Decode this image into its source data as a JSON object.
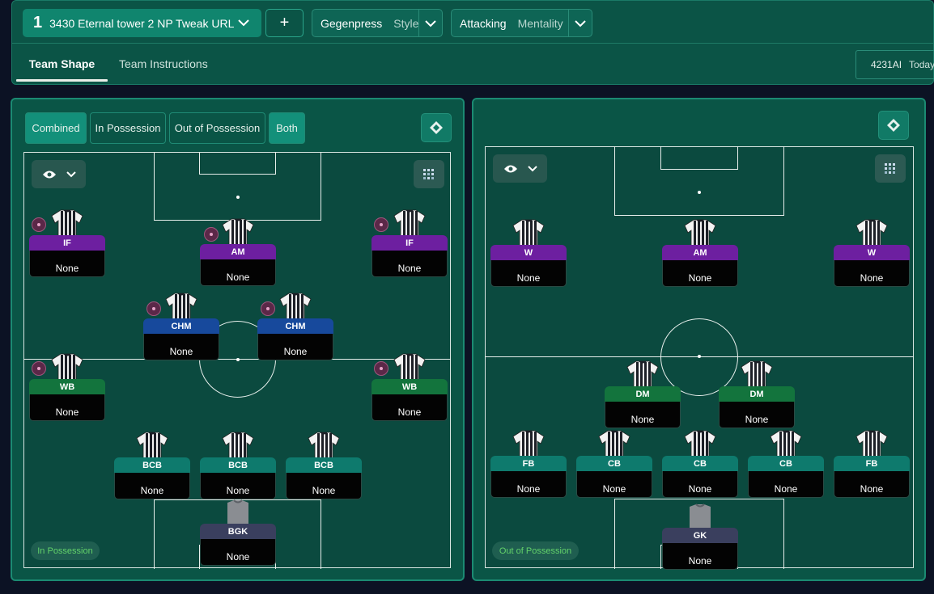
{
  "topbar": {
    "tactic_number": "1",
    "tactic_name": "3430 Eternal tower 2 NP Tweak URL",
    "add_label": "+",
    "style_value": "Gegenpress",
    "style_label": "Style",
    "mentality_value": "Attacking",
    "mentality_label": "Mentality",
    "tabs": [
      "Team Shape",
      "Team Instructions"
    ],
    "formation_code": "4231AI",
    "date_label": "Today"
  },
  "left_panel": {
    "segments": [
      "Combined",
      "In Possession",
      "Out of Possession",
      "Both"
    ],
    "badge": "In Possession",
    "players": [
      {
        "role": "IF",
        "duty": "None",
        "color": "#6d1fa0"
      },
      {
        "role": "AM",
        "duty": "None",
        "color": "#6d1fa0"
      },
      {
        "role": "IF",
        "duty": "None",
        "color": "#6d1fa0"
      },
      {
        "role": "CHM",
        "duty": "None",
        "color": "#17499c"
      },
      {
        "role": "CHM",
        "duty": "None",
        "color": "#17499c"
      },
      {
        "role": "WB",
        "duty": "None",
        "color": "#13743d"
      },
      {
        "role": "WB",
        "duty": "None",
        "color": "#13743d"
      },
      {
        "role": "BCB",
        "duty": "None",
        "color": "#0e7a6d"
      },
      {
        "role": "BCB",
        "duty": "None",
        "color": "#0e7a6d"
      },
      {
        "role": "BCB",
        "duty": "None",
        "color": "#0e7a6d"
      },
      {
        "role": "BGK",
        "duty": "None",
        "color": "#3a3f5e"
      }
    ]
  },
  "right_panel": {
    "badge": "Out of Possession",
    "players": [
      {
        "role": "W",
        "duty": "None",
        "color": "#6d1fa0"
      },
      {
        "role": "AM",
        "duty": "None",
        "color": "#6d1fa0"
      },
      {
        "role": "W",
        "duty": "None",
        "color": "#6d1fa0"
      },
      {
        "role": "DM",
        "duty": "None",
        "color": "#13743d"
      },
      {
        "role": "DM",
        "duty": "None",
        "color": "#13743d"
      },
      {
        "role": "FB",
        "duty": "None",
        "color": "#0e7a6d"
      },
      {
        "role": "CB",
        "duty": "None",
        "color": "#0e7a6d"
      },
      {
        "role": "CB",
        "duty": "None",
        "color": "#0e7a6d"
      },
      {
        "role": "CB",
        "duty": "None",
        "color": "#0e7a6d"
      },
      {
        "role": "FB",
        "duty": "None",
        "color": "#0e7a6d"
      },
      {
        "role": "GK",
        "duty": "None",
        "color": "#3a3f5e"
      }
    ]
  },
  "icons": [
    "chevron-down-icon",
    "plus-icon",
    "eye-icon",
    "grid-icon",
    "diamond-icon",
    "player-instruction-icon",
    "shirt-icon"
  ]
}
